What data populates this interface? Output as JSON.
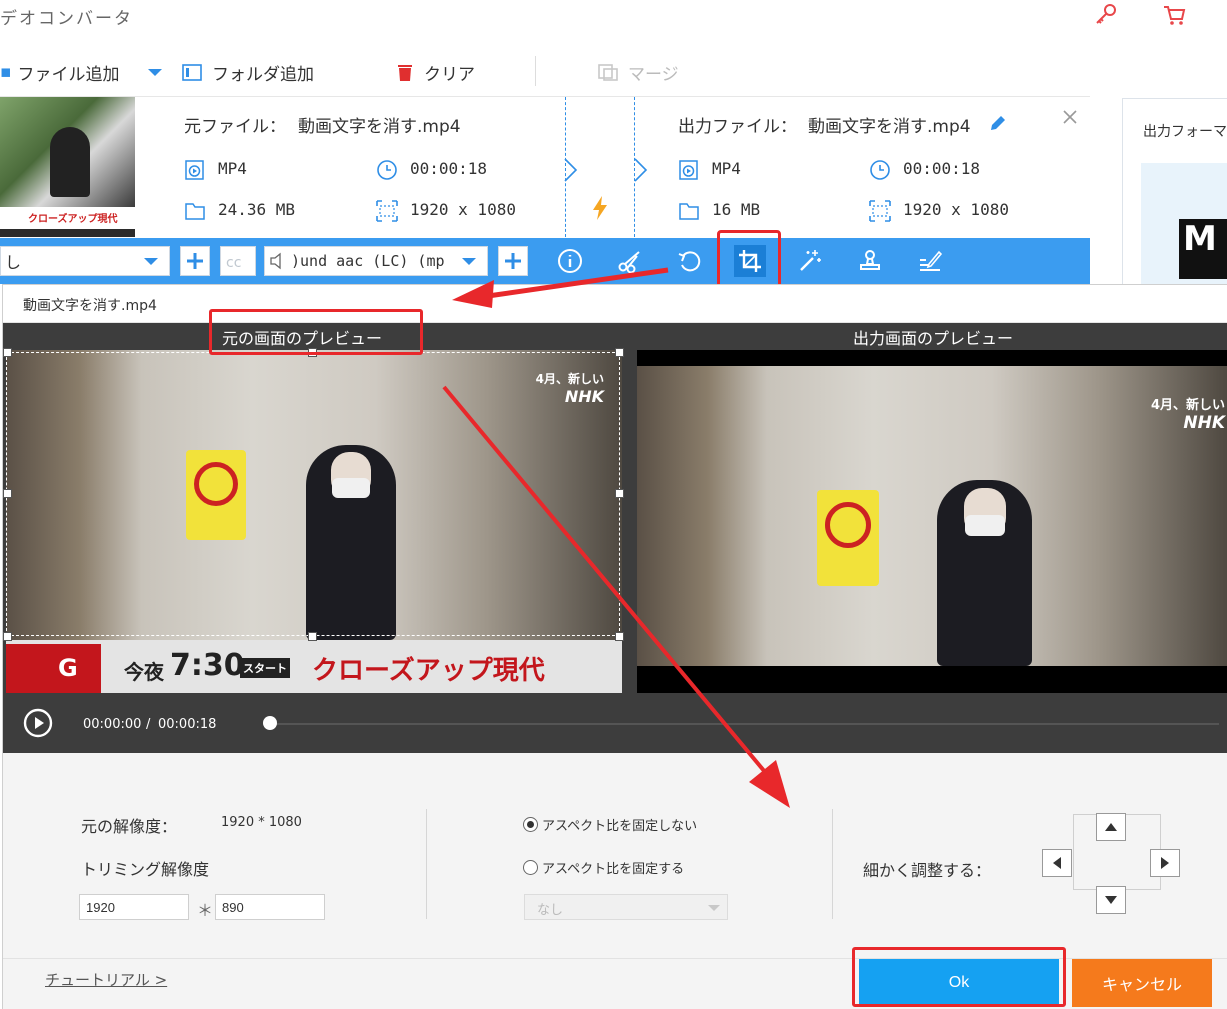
{
  "window": {
    "title": "デオコンバータ"
  },
  "toolbar": {
    "add_file": "ファイル追加",
    "add_folder": "フォルダ追加",
    "clear": "クリア",
    "merge": "マージ"
  },
  "file": {
    "source_label": "元ファイル：",
    "source_name": "動画文字を消す.mp4",
    "source_format": "MP4",
    "source_duration": "00:00:18",
    "source_size": "24.36 MB",
    "source_resolution": "1920 x 1080",
    "output_label": "出力ファイル：",
    "output_name": "動画文字を消す.mp4",
    "output_format": "MP4",
    "output_duration": "00:00:18",
    "output_size": "16 MB",
    "output_resolution": "1920 x 1080"
  },
  "side_panel": {
    "output_format_label": "出力フォーマ",
    "format_letter": "M"
  },
  "action_bar": {
    "subtitle_select": "し",
    "audio_select": ")und aac (LC) (mp"
  },
  "dialog": {
    "title": "動画文字を消す.mp4",
    "source_preview_label": "元の画面のプレビュー",
    "output_preview_label": "出力画面のプレビュー",
    "current_time": "00:00:00",
    "time_separator": "/",
    "total_time": "00:00:18",
    "playback_progress": 0.0
  },
  "video_overlay": {
    "nhk_line1": "4月、新しい",
    "nhk_line2": "NHK",
    "banner_letter": "G",
    "banner_tonight": "今夜",
    "banner_time": "7:30",
    "banner_start": "スタート",
    "banner_program": "クローズアップ現代",
    "thumb_program": "クローズアップ現代"
  },
  "settings": {
    "original_res_label": "元の解像度：",
    "original_res_value": "1920 * 1080",
    "trim_res_label": "トリミング解像度",
    "width": "1920",
    "times": "＊",
    "height": "890",
    "aspect_free": "アスペクト比を固定しない",
    "aspect_fixed": "アスペクト比を固定する",
    "ratio_select": "なし",
    "fine_tune_label": "細かく調整する："
  },
  "footer": {
    "tutorial": "チュートリアル >",
    "ok": "Ok",
    "cancel": "キャンセル"
  },
  "colors": {
    "accent_blue": "#3b9cf0",
    "ok_blue": "#15a1f2",
    "cancel_orange": "#f57a1c",
    "highlight_red": "#e8282b"
  }
}
